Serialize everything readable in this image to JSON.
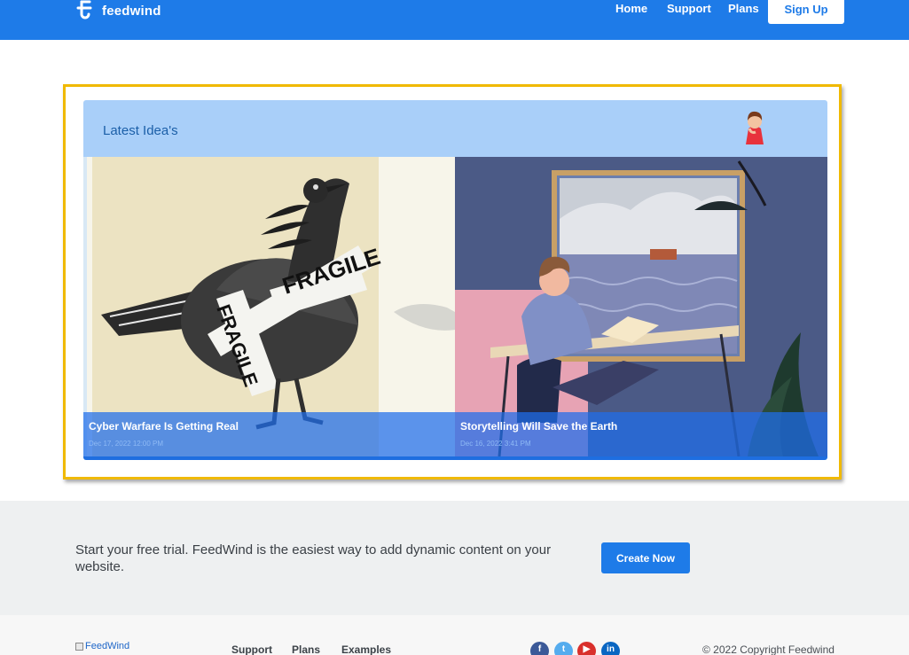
{
  "header": {
    "brand": "feedwind",
    "nav": {
      "home": "Home",
      "support": "Support",
      "plans": "Plans"
    },
    "signup_label": "Sign Up"
  },
  "widget": {
    "title": "Latest Idea's",
    "items": [
      {
        "title": "Cyber Warfare Is Getting Real",
        "date": "Dec 17, 2022 12:00 PM",
        "image_text": "FRAGILE"
      },
      {
        "title": "Storytelling Will Save the Earth",
        "date": "Dec 16, 2022 3:41 PM"
      }
    ]
  },
  "cta": {
    "text": "Start your free trial. FeedWind is the easiest way to add dynamic content on your website.",
    "button_label": "Create Now"
  },
  "footer": {
    "logo_alt": "FeedWind",
    "links": [
      "Support",
      "Plans",
      "Examples"
    ],
    "social": [
      "facebook-icon",
      "twitter-icon",
      "youtube-icon",
      "linkedin-icon"
    ],
    "copyright": "© 2022 Copyright Feedwind"
  },
  "colors": {
    "brand_blue": "#1e7be8",
    "widget_header": "#a9cff9",
    "highlight_border": "#f0b900"
  }
}
